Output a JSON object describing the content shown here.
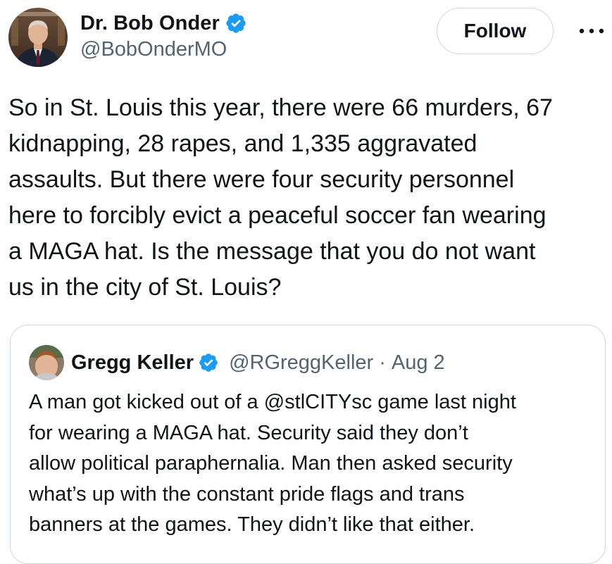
{
  "author": {
    "display_name": "Dr. Bob Onder",
    "handle": "@BobOnderMO",
    "verified": true,
    "avatar": "author-avatar"
  },
  "actions": {
    "follow_label": "Follow",
    "more_icon": "more-horizontal-icon"
  },
  "tweet": {
    "text": "So in St. Louis this year, there were 66 murders, 67\nkidnapping, 28 rapes, and 1,335 aggravated\nassaults. But there were four security personnel\nhere to forcibly evict a peaceful soccer fan wearing\na MAGA hat. Is the message that you do not want\nus in the city of St. Louis?"
  },
  "quote": {
    "display_name": "Gregg Keller",
    "handle": "@RGreggKeller",
    "separator": "·",
    "date": "Aug 2",
    "verified": true,
    "text": "A man got kicked out of a @stlCITYsc game last night\nfor wearing a MAGA hat. Security said they don’t\nallow political paraphernalia. Man then asked security\nwhat’s up with the constant pride flags and trans\nbanners at the games. They didn’t like that either."
  },
  "colors": {
    "text_primary": "#0f1419",
    "text_secondary": "#536471",
    "verified_blue": "#1d9bf0",
    "border": "#cfd9de"
  }
}
